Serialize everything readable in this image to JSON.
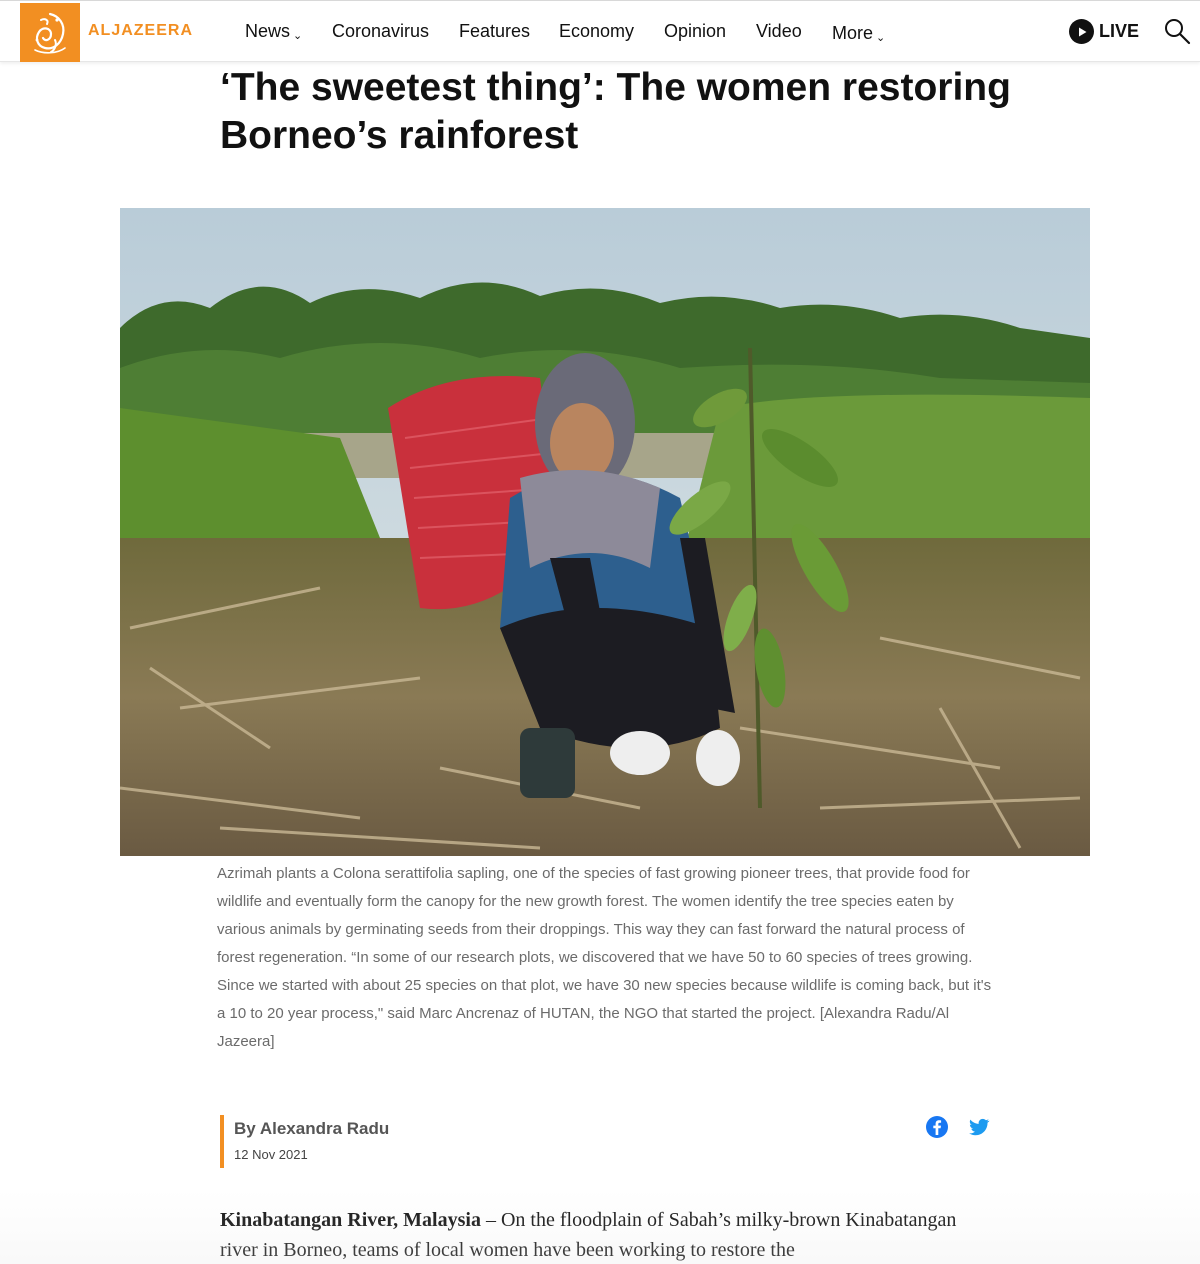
{
  "brand": {
    "logo_text": "ALJAZEERA",
    "accent_color": "#f28f22"
  },
  "nav": {
    "items": [
      {
        "label": "News",
        "has_dropdown": true
      },
      {
        "label": "Coronavirus",
        "has_dropdown": false
      },
      {
        "label": "Features",
        "has_dropdown": false
      },
      {
        "label": "Economy",
        "has_dropdown": false
      },
      {
        "label": "Opinion",
        "has_dropdown": false
      },
      {
        "label": "Video",
        "has_dropdown": false
      },
      {
        "label": "More",
        "has_dropdown": true
      }
    ],
    "live_label": "LIVE",
    "search_icon": "search-icon",
    "live_icon": "play-icon"
  },
  "article": {
    "headline": "‘The sweetest thing’: The women restoring Borneo’s rainforest",
    "caption": "Azrimah plants a Colona serattifolia sapling, one of the species of fast growing pioneer trees, that provide food for wildlife and eventually form the canopy for the new growth forest. The women identify the tree species eaten by various animals by germinating seeds from their droppings. This way they can fast forward the natural process of forest regeneration. “In some of our research plots, we discovered that we have 50 to 60 species of trees growing. Since we started with about 25 species on that plot, we have 30 new species because wildlife is coming back, but it's a 10 to 20 year process,\" said Marc Ancrenaz of HUTAN, the NGO that started the project. [Alexandra Radu/Al Jazeera]",
    "byline": "By Alexandra Radu",
    "date": "12 Nov 2021",
    "dateline": "Kinabatangan River, Malaysia",
    "lead_text": " – On the floodplain of Sabah’s milky-brown Kin­abatangan river in Borneo, teams of local women have been working to restore the",
    "share_icons": [
      "facebook-icon",
      "twitter-icon"
    ],
    "share_color": "#1877f2",
    "twitter_color": "#1d9bf0"
  }
}
